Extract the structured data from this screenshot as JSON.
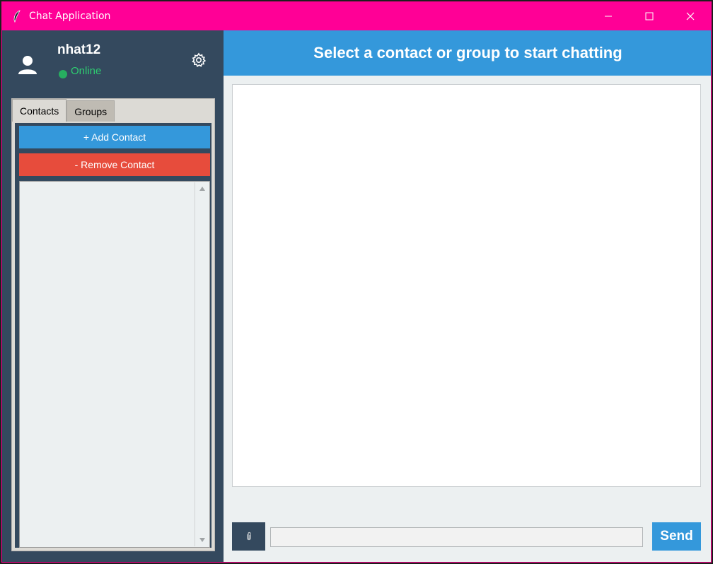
{
  "window": {
    "title": "Chat Application",
    "titlebar_color": "#ff0096",
    "controls": [
      "minimize-icon",
      "maximize-icon",
      "close-icon"
    ]
  },
  "sidebar": {
    "user": {
      "name": "nhat12",
      "status": "Online",
      "status_color": "#2ecc71",
      "avatar_icon": "user-icon",
      "settings_icon": "gear-icon"
    },
    "tabs": [
      {
        "label": "Contacts",
        "active": true
      },
      {
        "label": "Groups",
        "active": false
      }
    ],
    "buttons": {
      "add_contact": "+ Add Contact",
      "remove_contact": "- Remove Contact"
    },
    "contacts": []
  },
  "main": {
    "header_title": "Select a contact or group to start chatting",
    "accent_color": "#3498db",
    "messages": [],
    "composer": {
      "attach_icon": "paperclip-icon",
      "input_value": "",
      "input_placeholder": "",
      "send_label": "Send"
    }
  }
}
